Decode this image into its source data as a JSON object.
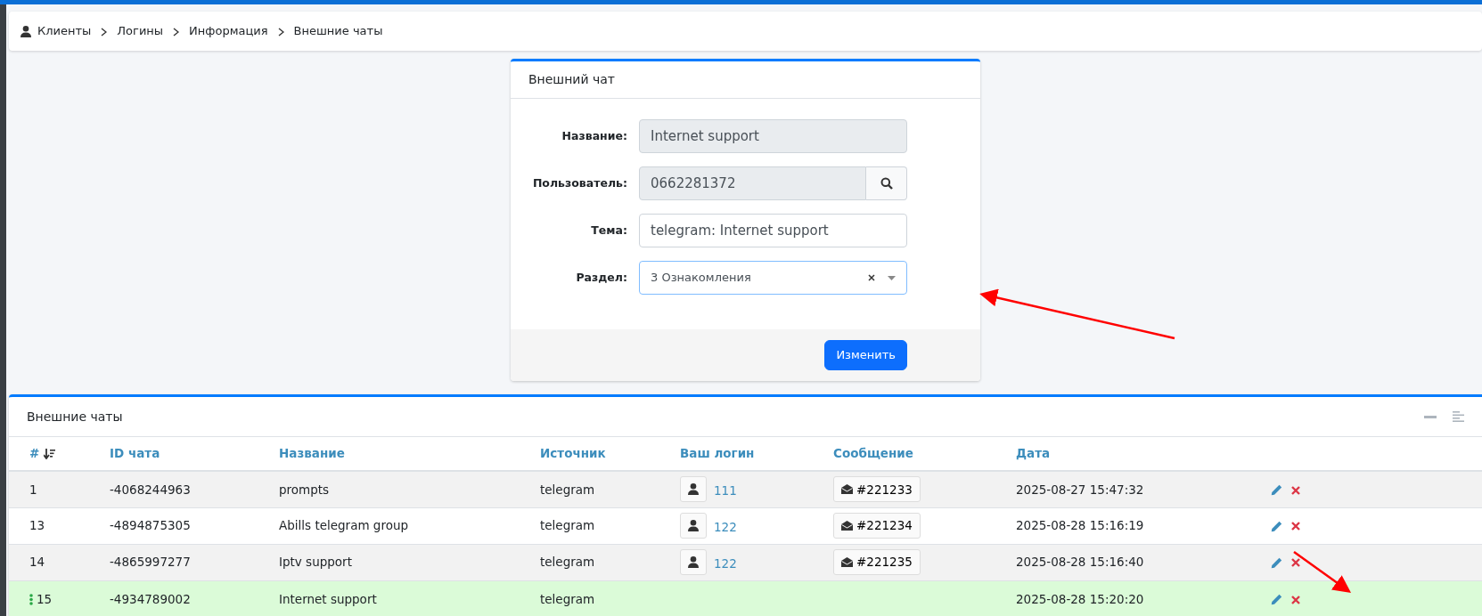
{
  "breadcrumb": [
    "Клиенты",
    "Логины",
    "Информация",
    "Внешние чаты"
  ],
  "form": {
    "title": "Внешний чат",
    "fields": [
      {
        "kind": "text",
        "label": "Название:",
        "value": "Internet support",
        "disabled": true
      },
      {
        "kind": "search",
        "label": "Пользователь:",
        "value": "0662281372",
        "disabled": true
      },
      {
        "kind": "text",
        "label": "Тема:",
        "value": "telegram: Internet support",
        "disabled": false
      },
      {
        "kind": "select",
        "label": "Раздел:",
        "value": "3 Ознакомления",
        "disabled": false
      }
    ],
    "submit": "Изменить"
  },
  "table": {
    "title": "Внешние чаты",
    "columns": [
      "#",
      "ID чата",
      "Название",
      "Источник",
      "Ваш логин",
      "Сообщение",
      "Дата"
    ],
    "rows": [
      {
        "num": "1",
        "chat_id": "-4068244963",
        "name": "prompts",
        "source": "telegram",
        "login": "111",
        "message": "#221233",
        "date": "2025-08-27 15:47:32",
        "selected": false
      },
      {
        "num": "13",
        "chat_id": "-4894875305",
        "name": "Abills telegram group",
        "source": "telegram",
        "login": "122",
        "message": "#221234",
        "date": "2025-08-28 15:16:19",
        "selected": false
      },
      {
        "num": "14",
        "chat_id": "-4865997277",
        "name": "Iptv support",
        "source": "telegram",
        "login": "122",
        "message": "#221235",
        "date": "2025-08-28 15:16:40",
        "selected": false
      },
      {
        "num": "15",
        "chat_id": "-4934789002",
        "name": "Internet support",
        "source": "telegram",
        "date": "2025-08-28 15:20:20",
        "selected": true
      }
    ]
  }
}
